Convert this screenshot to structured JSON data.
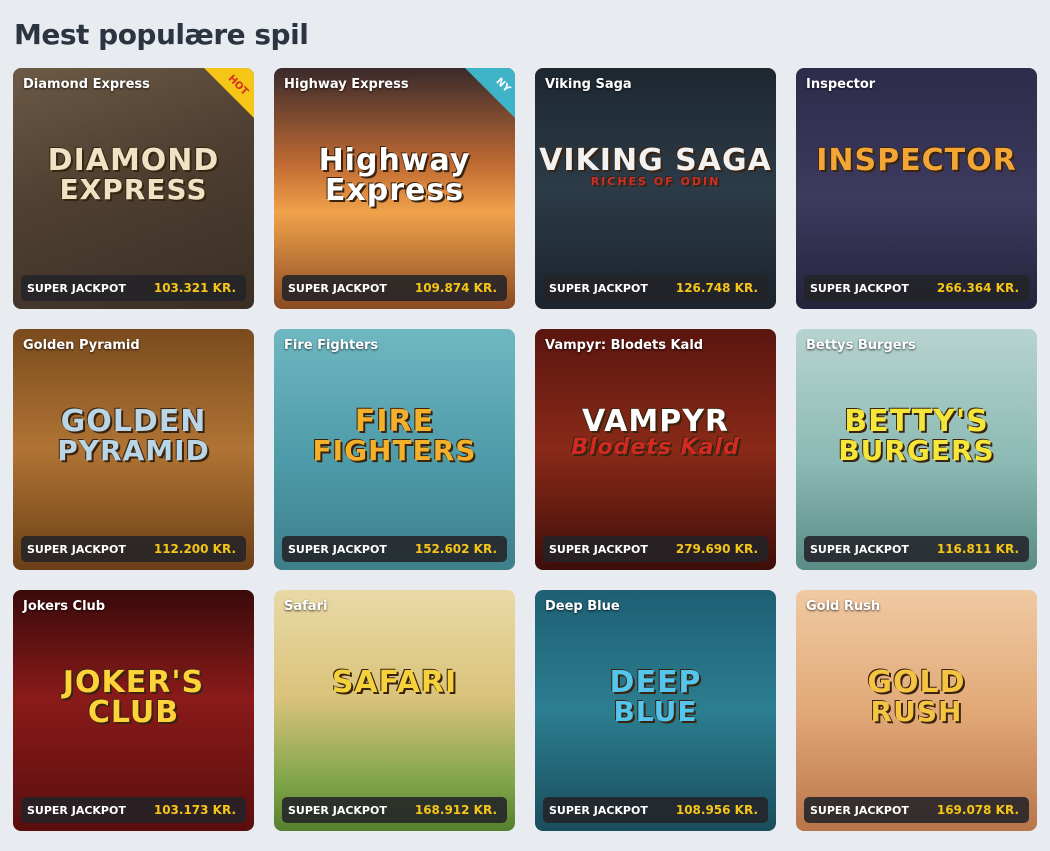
{
  "section": {
    "title": "Mest populære spil"
  },
  "games": [
    {
      "name": "Diamond Express",
      "logo": [
        "DIAMOND",
        "EXPRESS"
      ],
      "jackpot_label": "SUPER JACKPOT",
      "jackpot": "103.321 KR.",
      "badge": "HOT",
      "bg": "linear-gradient(160deg,#6d5a46 0%,#4e3f31 45%,#3a2e24 100%)",
      "logo_color": "#efe3c6"
    },
    {
      "name": "Highway Express",
      "logo": [
        "Highway",
        "Express"
      ],
      "jackpot_label": "SUPER JACKPOT",
      "jackpot": "109.874 KR.",
      "badge": "NY",
      "bg": "linear-gradient(180deg,#3a2a2c 0%,#c06a33 40%,#f0a24a 60%,#8a4a22 100%)",
      "logo_color": "#ffffff"
    },
    {
      "name": "Viking Saga",
      "logo": [
        "VIKING SAGA",
        "RICHES OF ODIN"
      ],
      "jackpot_label": "SUPER JACKPOT",
      "jackpot": "126.748 KR.",
      "badge": "",
      "bg": "linear-gradient(180deg,#1d2730 0%,#2c3b48 50%,#1b232c 100%)",
      "logo_color": "#f2f2f2"
    },
    {
      "name": "Inspector",
      "logo": [
        "INSPECTOR",
        ""
      ],
      "jackpot_label": "SUPER JACKPOT",
      "jackpot": "266.364 KR.",
      "badge": "",
      "bg": "linear-gradient(180deg,#2d2c4a 0%,#3d3a5e 55%,#24233b 100%)",
      "logo_color": "#f3a636"
    },
    {
      "name": "Golden Pyramid",
      "logo": [
        "GOLDEN",
        "PYRAMID"
      ],
      "jackpot_label": "SUPER JACKPOT",
      "jackpot": "112.200 KR.",
      "badge": "",
      "bg": "linear-gradient(180deg,#7a4b1e 0%,#b07434 50%,#6b3f17 100%)",
      "logo_color": "#b9d5e6"
    },
    {
      "name": "Fire Fighters",
      "logo": [
        "FIRE",
        "FIGHTERS"
      ],
      "jackpot_label": "SUPER JACKPOT",
      "jackpot": "152.602 KR.",
      "badge": "",
      "bg": "linear-gradient(180deg,#6fb8c2 0%,#4d9aa8 55%,#3d7f8a 100%)",
      "logo_color": "#f3b02a"
    },
    {
      "name": "Vampyr: Blodets Kald",
      "logo": [
        "VAMPYR",
        "Blodets Kald"
      ],
      "jackpot_label": "SUPER JACKPOT",
      "jackpot": "279.690 KR.",
      "badge": "",
      "bg": "linear-gradient(180deg,#5a1510 0%,#8a2a18 50%,#3e0e0a 100%)",
      "logo_color": "#ffffff"
    },
    {
      "name": "Bettys Burgers",
      "logo": [
        "BETTY'S",
        "BURGERS"
      ],
      "jackpot_label": "SUPER JACKPOT",
      "jackpot": "116.811 KR.",
      "badge": "",
      "bg": "linear-gradient(180deg,#b7d3cf 0%,#8cbab4 55%,#5a8b85 100%)",
      "logo_color": "#f5e63a"
    },
    {
      "name": "Jokers Club",
      "logo": [
        "JOKER'S",
        "CLUB"
      ],
      "jackpot_label": "SUPER JACKPOT",
      "jackpot": "103.173 KR.",
      "badge": "",
      "bg": "linear-gradient(180deg,#3a0a0a 0%,#8a1a1a 45%,#5a0e0e 100%)",
      "logo_color": "#ffd23a"
    },
    {
      "name": "Safari",
      "logo": [
        "SAFARI",
        ""
      ],
      "jackpot_label": "SUPER JACKPOT",
      "jackpot": "168.912 KR.",
      "badge": "",
      "bg": "linear-gradient(180deg,#e9d9a6 0%,#d9c27a 45%,#7fa548 80%,#56802e 100%)",
      "logo_color": "#f5d23c"
    },
    {
      "name": "Deep Blue",
      "logo": [
        "DEEP",
        "BLUE"
      ],
      "jackpot_label": "SUPER JACKPOT",
      "jackpot": "108.956 KR.",
      "badge": "",
      "bg": "linear-gradient(180deg,#1f5f74 0%,#2b7e90 50%,#1a4d5c 100%)",
      "logo_color": "#54c6ee"
    },
    {
      "name": "Gold Rush",
      "logo": [
        "GOLD",
        "RUSH"
      ],
      "jackpot_label": "SUPER JACKPOT",
      "jackpot": "169.078 KR.",
      "badge": "",
      "bg": "linear-gradient(180deg,#f0c9a2 0%,#e2a978 50%,#b8754a 100%)",
      "logo_color": "#f5c542"
    }
  ]
}
